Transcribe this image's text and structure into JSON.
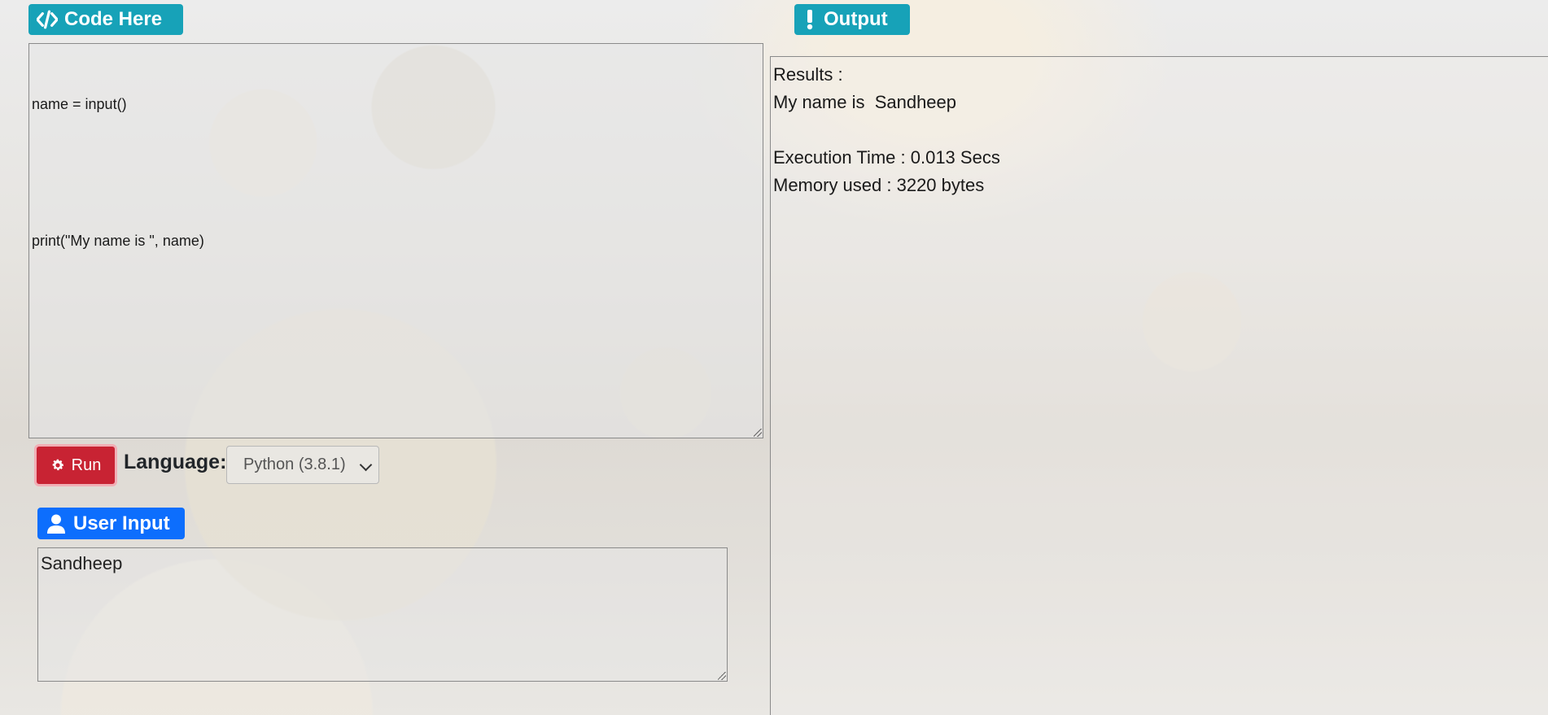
{
  "code_section": {
    "header_label": "Code Here",
    "header_icon": "code-icon",
    "code_lines": [
      "name = input()",
      "",
      "print(\"My name is \", name)"
    ]
  },
  "output_section": {
    "header_label": "Output",
    "header_icon": "exclamation-icon",
    "results_label": "Results :",
    "result_line": "My name is  Sandheep",
    "execution_time": "Execution Time : 0.013 Secs",
    "memory_used": "Memory used : 3220 bytes"
  },
  "controls": {
    "run_label": "Run",
    "run_icon": "gear-icon",
    "language_label": "Language:",
    "language_selected": "Python (3.8.1)"
  },
  "user_input_section": {
    "header_label": "User Input",
    "header_icon": "user-icon",
    "value": "Sandheep"
  },
  "colors": {
    "teal_badge": "#17a2b8",
    "blue_badge": "#0d6efd",
    "run_button": "#c82333"
  }
}
